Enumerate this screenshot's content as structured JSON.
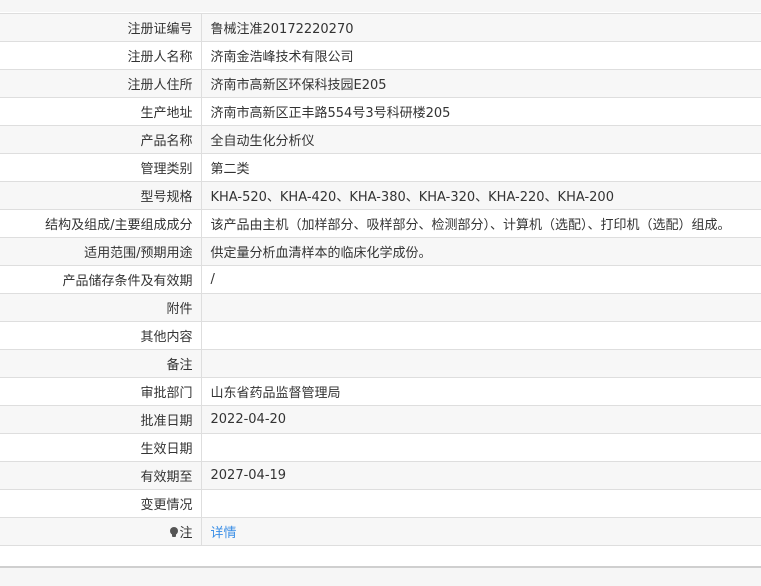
{
  "rows": [
    {
      "label": "注册证编号",
      "value": "鲁械注准20172220270"
    },
    {
      "label": "注册人名称",
      "value": "济南金浩峰技术有限公司"
    },
    {
      "label": "注册人住所",
      "value": "济南市高新区环保科技园E205"
    },
    {
      "label": "生产地址",
      "value": "济南市高新区正丰路554号3号科研楼205"
    },
    {
      "label": "产品名称",
      "value": "全自动生化分析仪"
    },
    {
      "label": "管理类别",
      "value": "第二类"
    },
    {
      "label": "型号规格",
      "value": "KHA-520、KHA-420、KHA-380、KHA-320、KHA-220、KHA-200"
    },
    {
      "label": "结构及组成/主要组成成分",
      "value": "该产品由主机（加样部分、吸样部分、检测部分）、计算机（选配）、打印机（选配）组成。"
    },
    {
      "label": "适用范围/预期用途",
      "value": "供定量分析血清样本的临床化学成份。"
    },
    {
      "label": "产品储存条件及有效期",
      "value": "/"
    },
    {
      "label": "附件",
      "value": ""
    },
    {
      "label": "其他内容",
      "value": ""
    },
    {
      "label": "备注",
      "value": ""
    },
    {
      "label": "审批部门",
      "value": "山东省药品监督管理局"
    },
    {
      "label": "批准日期",
      "value": "2022-04-20"
    },
    {
      "label": "生效日期",
      "value": ""
    },
    {
      "label": "有效期至",
      "value": "2027-04-19"
    },
    {
      "label": "变更情况",
      "value": ""
    }
  ],
  "note_row": {
    "icon": "lightbulb-icon",
    "label": "注",
    "link_text": "详情",
    "link_color": "#3a8ee6"
  }
}
